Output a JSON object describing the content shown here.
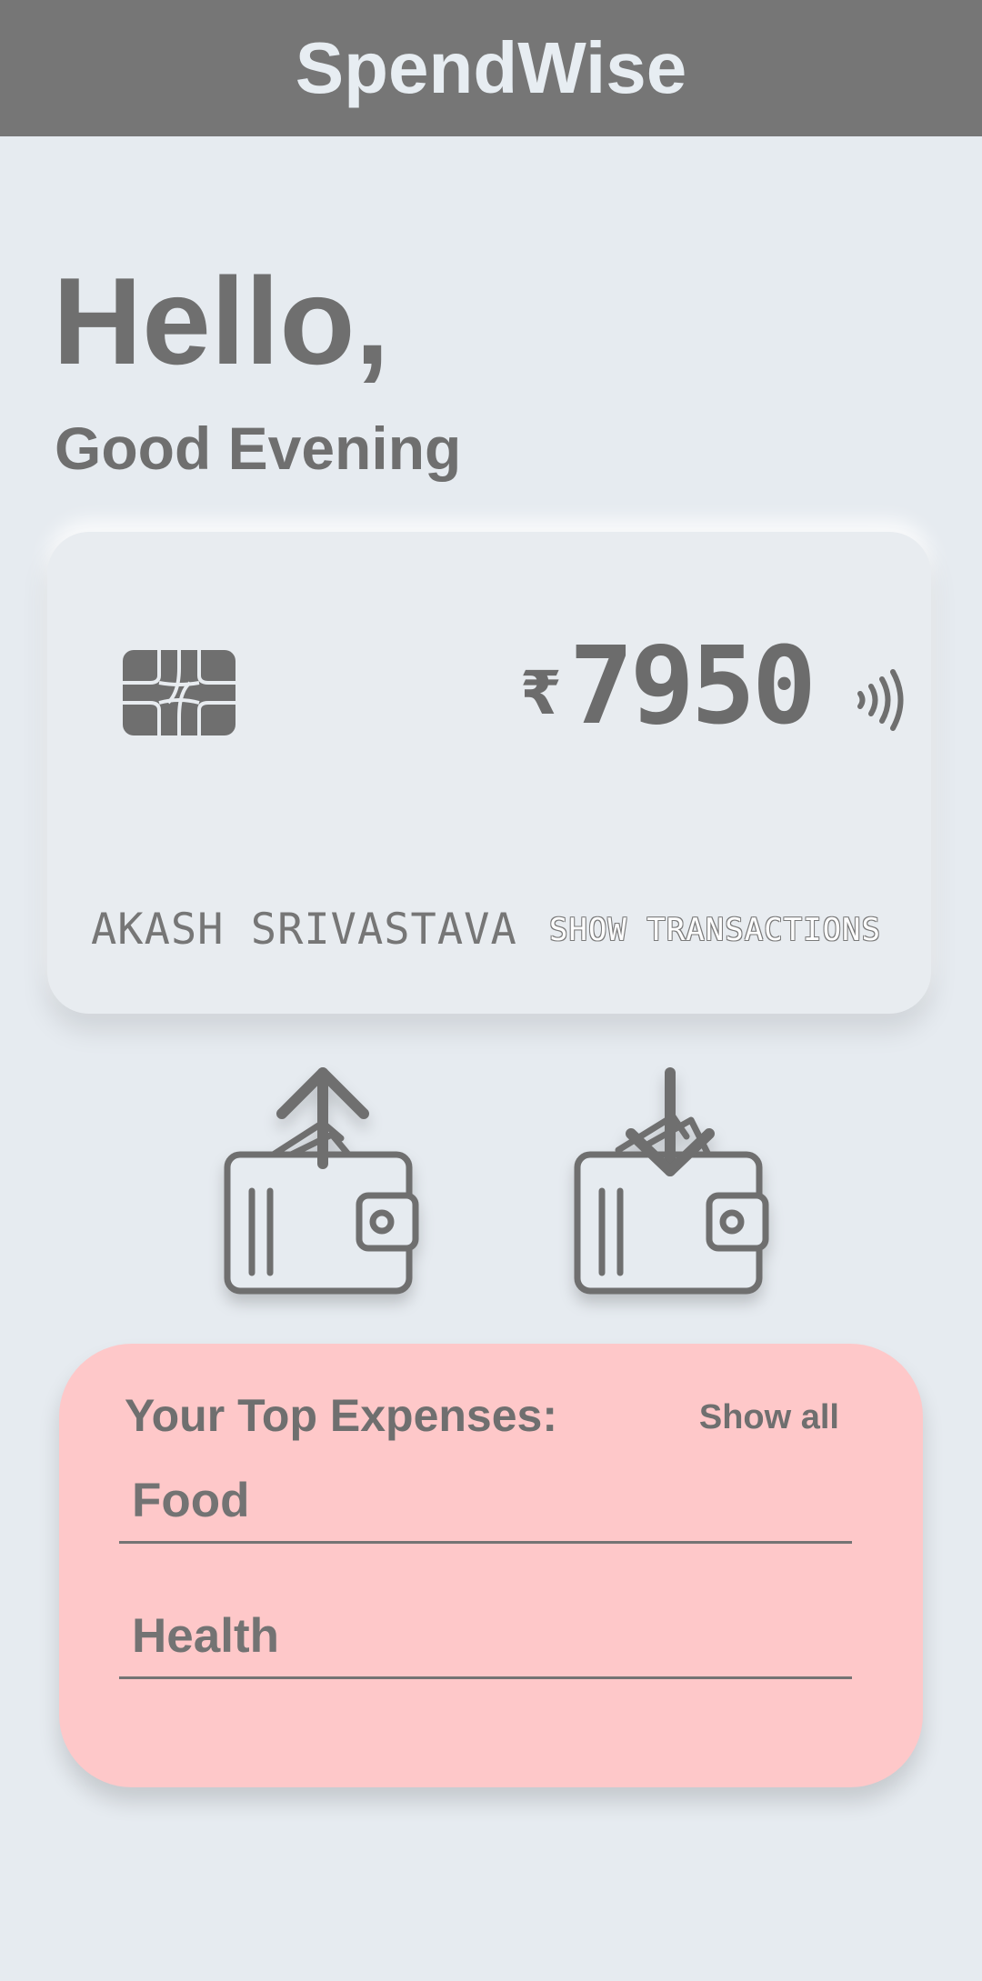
{
  "app": {
    "title": "SpendWise"
  },
  "greeting": {
    "hello": "Hello,",
    "time_of_day": "Good Evening"
  },
  "card": {
    "currency_symbol": "₹",
    "balance": "7950",
    "holder_name": "AKASH SRIVASTAVA",
    "transactions_link": "SHOW TRANSACTIONS",
    "icons": [
      "chip-icon",
      "contactless-icon"
    ]
  },
  "actions": [
    {
      "name": "withdraw-wallet-button",
      "icon": "wallet-arrow-up-icon"
    },
    {
      "name": "deposit-wallet-button",
      "icon": "wallet-arrow-down-icon"
    }
  ],
  "expenses": {
    "title": "Your Top Expenses:",
    "show_all_label": "Show all",
    "items": [
      "Food",
      "Health"
    ]
  },
  "colors": {
    "header_bg": "#767676",
    "background": "#e6ebf0",
    "text": "#6f6f6f",
    "expense_card_bg": "#fec8c9"
  }
}
